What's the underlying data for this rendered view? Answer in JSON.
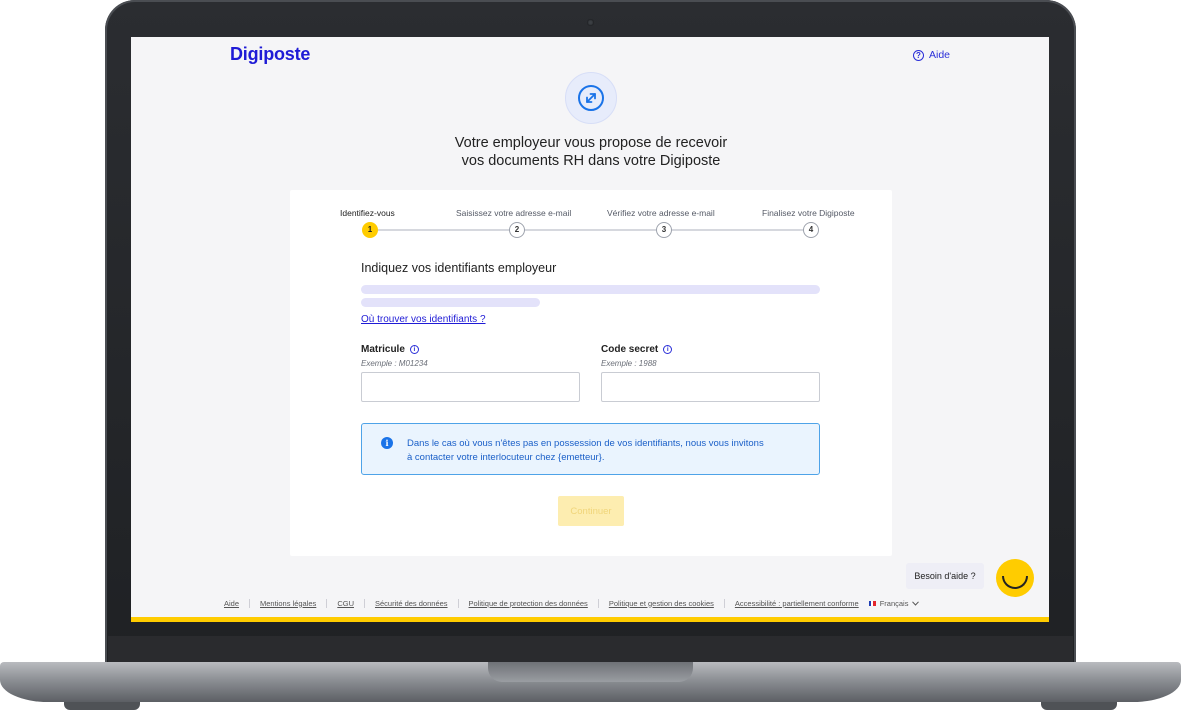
{
  "app": {
    "logo": "Digiposte"
  },
  "header": {
    "help_label": "Aide"
  },
  "page": {
    "title_line1": "Votre employeur vous propose de recevoir",
    "title_line2": "vos documents RH dans votre Digiposte"
  },
  "steps": [
    {
      "number": "1",
      "label": "Identifiez-vous",
      "active": true
    },
    {
      "number": "2",
      "label": "Saisissez votre adresse e-mail",
      "active": false
    },
    {
      "number": "3",
      "label": "Vérifiez votre adresse e-mail",
      "active": false
    },
    {
      "number": "4",
      "label": "Finalisez votre Digiposte",
      "active": false
    }
  ],
  "form": {
    "title": "Indiquez vos identifiants employeur",
    "where_link": "Où trouver vos identifiants ?",
    "matricule": {
      "label": "Matricule",
      "hint": "Exemple : M01234",
      "value": ""
    },
    "code": {
      "label": "Code secret",
      "hint": "Exemple : 1988",
      "value": ""
    },
    "notice_line1": "Dans le cas où vous n'êtes pas en possession de vos identifiants, nous vous invitons",
    "notice_line2": "à contacter votre interlocuteur chez {emetteur}.",
    "continue_label": "Continuer"
  },
  "help_widget": {
    "label": "Besoin d'aide ?"
  },
  "footer": {
    "links": [
      "Aide",
      "Mentions légales",
      "CGU",
      "Sécurité des données",
      "Politique de protection des données",
      "Politique et gestion des cookies",
      "Accessibilité : partiellement conforme"
    ],
    "language": "Français"
  },
  "colors": {
    "brand": "#1f1bd6",
    "accent_yellow": "#ffcc00",
    "notice_blue": "#1a73e8"
  }
}
